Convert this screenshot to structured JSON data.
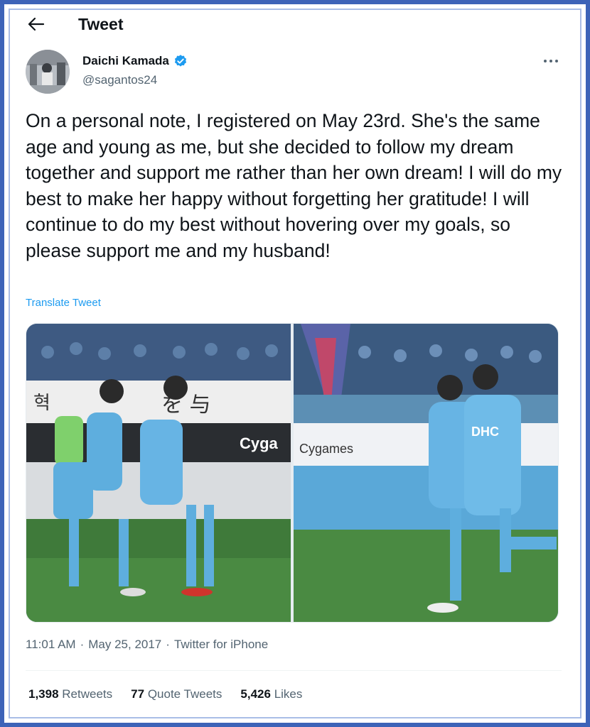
{
  "header": {
    "title": "Tweet"
  },
  "author": {
    "name": "Daichi Kamada",
    "handle": "@sagantos24"
  },
  "tweet": {
    "text": "On a personal note, I registered on May 23rd. She's the same age and young as me, but she decided to follow my dream together and support me rather than her own dream! I will do my best to make her happy without forgetting her gratitude! I will continue to do my best without hovering over my goals, so please support me and my husband!",
    "translate_label": "Translate Tweet"
  },
  "media": {
    "left_banner_texts": [
      "Cyga"
    ],
    "right_banner_texts": [
      "Cygames",
      "DHC"
    ]
  },
  "meta": {
    "time": "11:01 AM",
    "date": "May 25, 2017",
    "source": "Twitter for iPhone",
    "sep": "·"
  },
  "stats": {
    "retweets_count": "1,398",
    "retweets_label": "Retweets",
    "quotes_count": "77",
    "quotes_label": "Quote Tweets",
    "likes_count": "5,426",
    "likes_label": "Likes"
  },
  "colors": {
    "border": "#3d63b8",
    "link": "#1d9bf0",
    "verified": "#1d9bf0",
    "muted": "#536471"
  },
  "icons": {
    "back": "arrow-left-icon",
    "verified": "verified-badge-icon",
    "more": "more-dots-icon"
  }
}
